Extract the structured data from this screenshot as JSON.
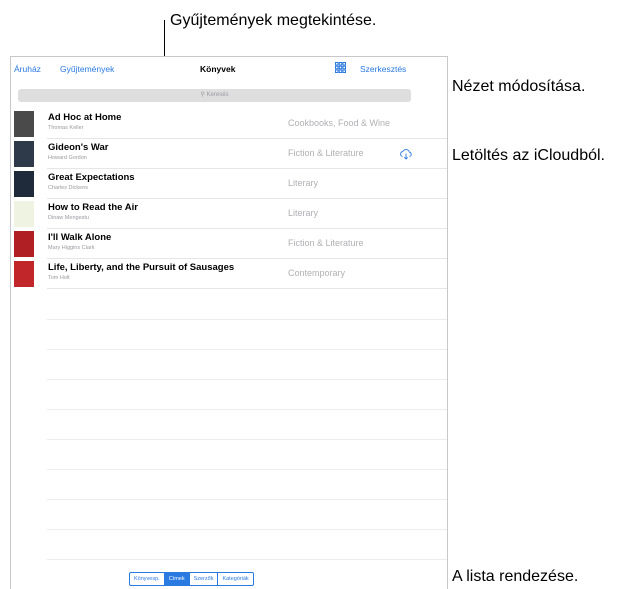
{
  "callouts": {
    "collections": "Gyűjtemények megtekintése.",
    "view_change": "Nézet módosítása.",
    "icloud": "Letöltés az iCloudból.",
    "sort": "A lista rendezése."
  },
  "nav": {
    "store": "Áruház",
    "collections": "Gyűjtemények",
    "title": "Könyvek",
    "edit": "Szerkesztés",
    "grid_icon": "grid-icon"
  },
  "search": {
    "placeholder": "Keresés"
  },
  "books": [
    {
      "title": "Ad Hoc at Home",
      "author": "Thomas Keller",
      "category": "Cookbooks, Food & Wine",
      "cover_color": "#4a4a4a"
    },
    {
      "title": "Gideon's War",
      "author": "Howard Gordon",
      "category": "Fiction & Literature",
      "cover_color": "#2e3a4a",
      "cloud": true
    },
    {
      "title": "Great Expectations",
      "author": "Charles Dickens",
      "category": "Literary",
      "cover_color": "#1f2a3a"
    },
    {
      "title": "How to Read the Air",
      "author": "Dinaw Mengestu",
      "category": "Literary",
      "cover_color": "#eef3e2"
    },
    {
      "title": "I'll Walk Alone",
      "author": "Mary Higgins Clark",
      "category": "Fiction & Literature",
      "cover_color": "#b01f23"
    },
    {
      "title": "Life, Liberty, and the Pursuit of Sausages",
      "author": "Tom Holt",
      "category": "Contemporary",
      "cover_color": "#c0262a"
    }
  ],
  "sort_options": [
    {
      "label": "Könyvesp.",
      "active": false
    },
    {
      "label": "Címek",
      "active": true
    },
    {
      "label": "Szerzők",
      "active": false
    },
    {
      "label": "Kategóriák",
      "active": false
    }
  ],
  "colors": {
    "accent": "#2a7ae2"
  }
}
